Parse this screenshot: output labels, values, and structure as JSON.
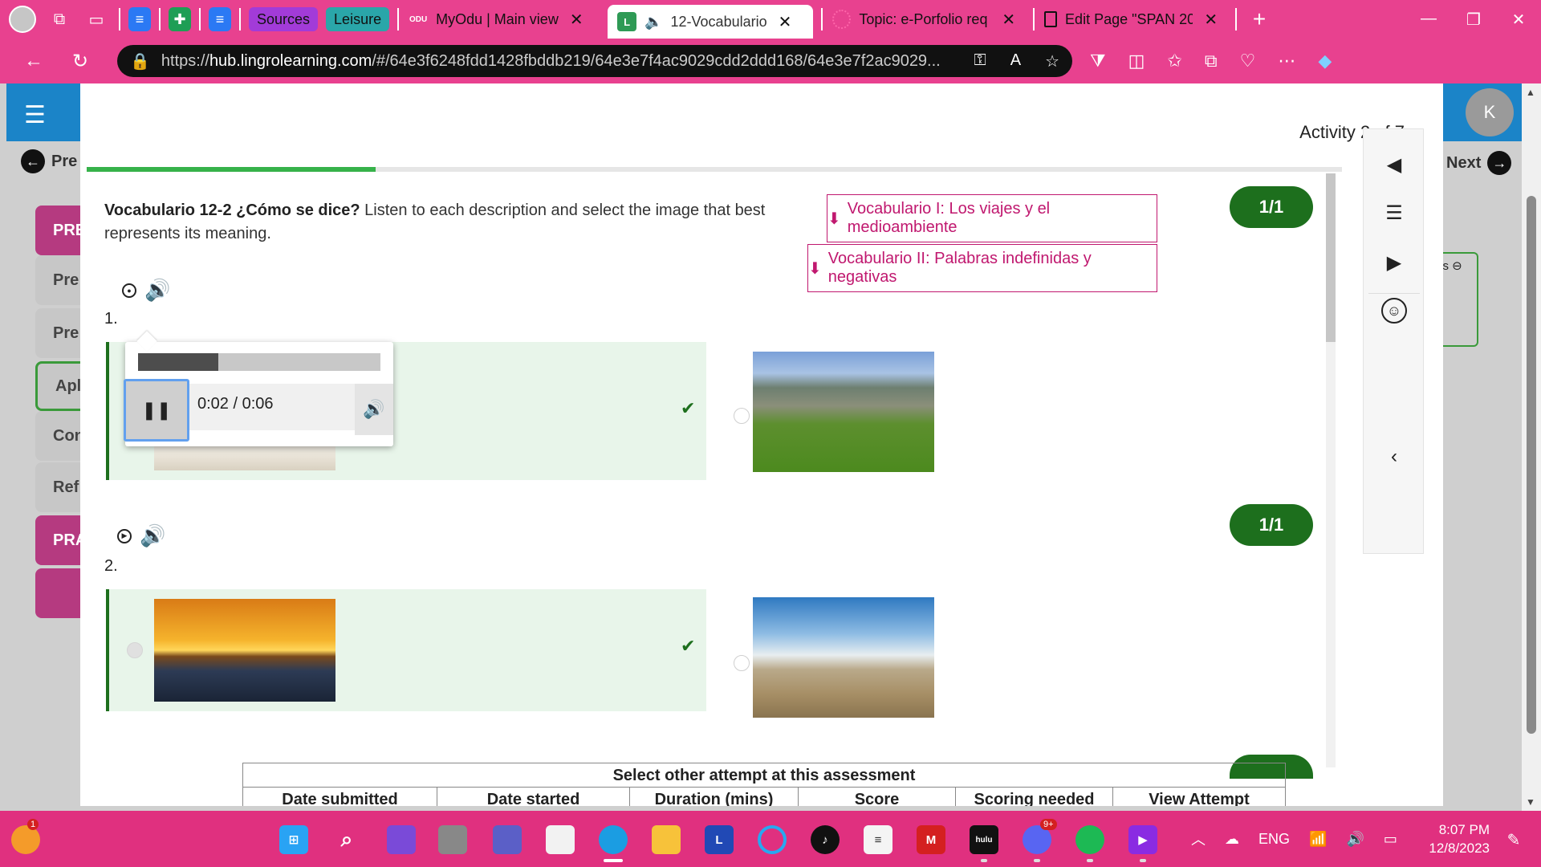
{
  "browser": {
    "groups": [
      "Sources",
      "Leisure"
    ],
    "tabs": [
      {
        "title": "MyOdu | Main view",
        "active": false
      },
      {
        "title": "12-Vocabulario",
        "active": true
      },
      {
        "title": "Topic: e-Porfolio req",
        "active": false
      },
      {
        "title": "Edit Page \"SPAN 201",
        "active": false
      }
    ],
    "url_host": "hub.lingrolearning.com",
    "url_rest": "/#/64e3f6248fdd1428fbddb219/64e3e7f4ac9029cdd2ddd168/64e3e7f2ac9029...",
    "url_prefix": "https://"
  },
  "background_page": {
    "prev_label": "Pre",
    "next_label": "Next",
    "avatar_initial": "K",
    "side_items": [
      "PRE",
      "Pre",
      "Pre",
      "Apl",
      "Con",
      "Ref",
      "PRA"
    ],
    "right_box_label": "ss"
  },
  "modal": {
    "activity_count": "Activity 2 of 7",
    "progress_fraction": 0.23,
    "instruction_bold": "Vocabulario 12-2 ¿Cómo se dice?",
    "instruction_rest": " Listen to each description and select the image that best represents its meaning.",
    "download_buttons": [
      "Vocabulario I: Los viajes y el medioambiente",
      "Vocabulario II: Palabras indefinidas y negativas"
    ],
    "questions": [
      {
        "number": "1.",
        "score": "1/1"
      },
      {
        "number": "2.",
        "score": "1/1"
      }
    ],
    "audio_player": {
      "time": "0:02 / 0:06",
      "progress_fraction": 0.33
    },
    "attempt_table": {
      "title": "Select other attempt at this assessment",
      "headers": [
        "Date submitted",
        "Date started",
        "Duration (mins)",
        "Score",
        "Scoring needed",
        "View Attempt"
      ]
    }
  },
  "taskbar": {
    "language": "ENG",
    "time": "8:07 PM",
    "date": "12/8/2023",
    "discord_badge": "9+",
    "notif_badge": "1"
  },
  "colors": {
    "chrome": "#e8418f",
    "taskbar": "#e0307f",
    "accent_magenta": "#c0186f",
    "score_green": "#1d6f1d",
    "progress_green": "#36b24a"
  }
}
